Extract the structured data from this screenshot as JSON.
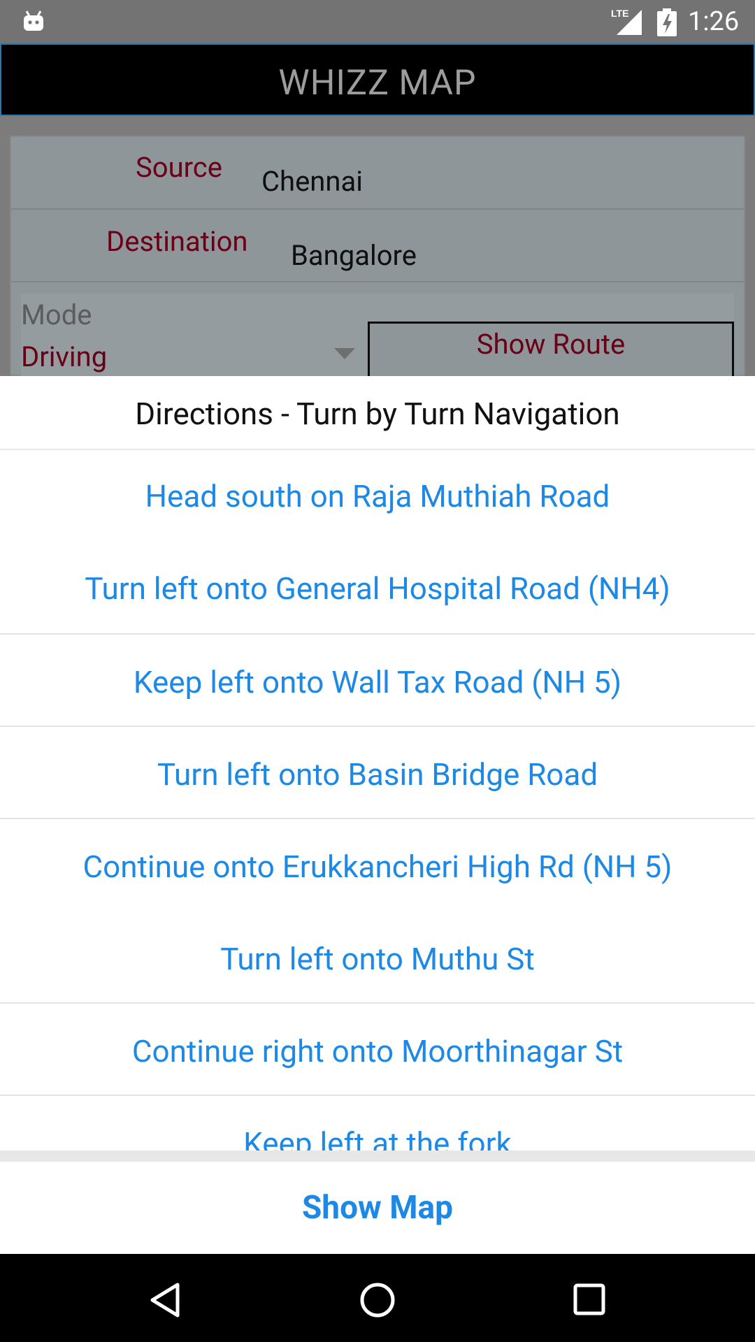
{
  "status_bar": {
    "time": "1:26",
    "network": "LTE"
  },
  "app_bar": {
    "title": "WHIZZ MAP"
  },
  "form": {
    "source_label": "Source",
    "source_value": "Chennai",
    "destination_label": "Destination",
    "destination_value": "Bangalore",
    "mode_label": "Mode",
    "mode_value": "Driving",
    "show_route_label": "Show Route"
  },
  "dialog": {
    "title": "Directions - Turn by Turn Navigation",
    "steps": [
      "Head south on Raja Muthiah Road",
      "Turn left onto General Hospital Road (NH4)",
      "Keep left onto Wall Tax Road (NH 5)",
      "Turn left onto Basin Bridge Road",
      "Continue onto Erukkancheri High Rd (NH 5)",
      "Turn left onto Muthu St",
      "Continue right onto Moorthinagar St",
      "Keep left at the fork"
    ],
    "show_map_label": "Show Map"
  },
  "colors": {
    "link": "#1e88e5",
    "label": "#6a0017",
    "app_bar": "#000000",
    "status_bar": "#737373"
  },
  "icons": [
    "android-debug-icon",
    "lte-signal-icon",
    "battery-charging-icon",
    "dropdown-arrow-icon",
    "back-nav-icon",
    "home-nav-icon",
    "recents-nav-icon"
  ]
}
